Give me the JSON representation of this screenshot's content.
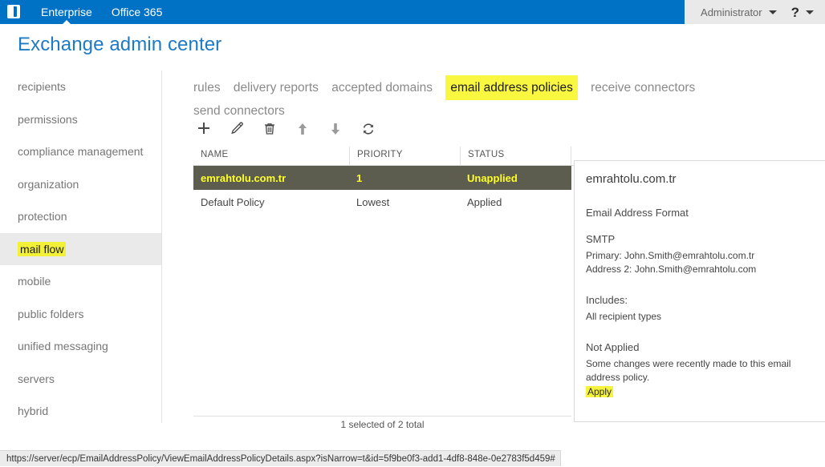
{
  "suitebar": {
    "logo_name": "office-logo",
    "links": [
      {
        "label": "Enterprise",
        "active": true
      },
      {
        "label": "Office 365",
        "active": false
      }
    ],
    "account": "Administrator",
    "help_glyph": "?"
  },
  "page": {
    "title": "Exchange admin center"
  },
  "sidebar": {
    "items": [
      {
        "label": "recipients",
        "selected": false
      },
      {
        "label": "permissions",
        "selected": false
      },
      {
        "label": "compliance management",
        "selected": false
      },
      {
        "label": "organization",
        "selected": false
      },
      {
        "label": "protection",
        "selected": false
      },
      {
        "label": "mail flow",
        "selected": true,
        "highlighted": true
      },
      {
        "label": "mobile",
        "selected": false
      },
      {
        "label": "public folders",
        "selected": false
      },
      {
        "label": "unified messaging",
        "selected": false
      },
      {
        "label": "servers",
        "selected": false
      },
      {
        "label": "hybrid",
        "selected": false
      }
    ]
  },
  "tabs": [
    {
      "label": "rules",
      "active": false
    },
    {
      "label": "delivery reports",
      "active": false
    },
    {
      "label": "accepted domains",
      "active": false
    },
    {
      "label": "email address policies",
      "active": true
    },
    {
      "label": "receive connectors",
      "active": false
    },
    {
      "label": "send connectors",
      "active": false
    }
  ],
  "toolbar": {
    "buttons": [
      {
        "name": "add-icon",
        "title": "New"
      },
      {
        "name": "edit-pencil-icon",
        "title": "Edit"
      },
      {
        "name": "delete-trash-icon",
        "title": "Delete"
      },
      {
        "name": "arrow-up-icon",
        "title": "Move up"
      },
      {
        "name": "arrow-down-icon",
        "title": "Move down"
      },
      {
        "name": "refresh-icon",
        "title": "Refresh"
      }
    ]
  },
  "grid": {
    "columns": [
      "NAME",
      "PRIORITY",
      "STATUS"
    ],
    "rows": [
      {
        "name": "emrahtolu.com.tr",
        "priority": "1",
        "status": "Unapplied",
        "selected": true
      },
      {
        "name": "Default Policy",
        "priority": "Lowest",
        "status": "Applied",
        "selected": false
      }
    ],
    "count_text": "1 selected of 2 total"
  },
  "detail": {
    "title": "emrahtolu.com.tr",
    "format_heading": "Email Address Format",
    "protocol": "SMTP",
    "primary": "Primary: John.Smith@emrahtolu.com.tr",
    "address2": "Address 2: John.Smith@emrahtolu.com",
    "includes_heading": "Includes:",
    "includes_value": "All recipient types",
    "status_heading": "Not Applied",
    "status_text": "Some changes were recently made to this email address policy.",
    "apply_link": "Apply"
  },
  "statusbar": {
    "url": "https://server/ecp/EmailAddressPolicy/ViewEmailAddressPolicyDetails.aspx?isNarrow=t&id=5f9be0f3-add1-4df8-848e-0e2783f5d459#"
  },
  "colors": {
    "brand_blue": "#0072c6",
    "title_blue": "#1e7ac4",
    "highlight_yellow": "#f5f33c",
    "selected_row_bg": "#5d5d4f",
    "selected_row_text": "#ffff29"
  }
}
